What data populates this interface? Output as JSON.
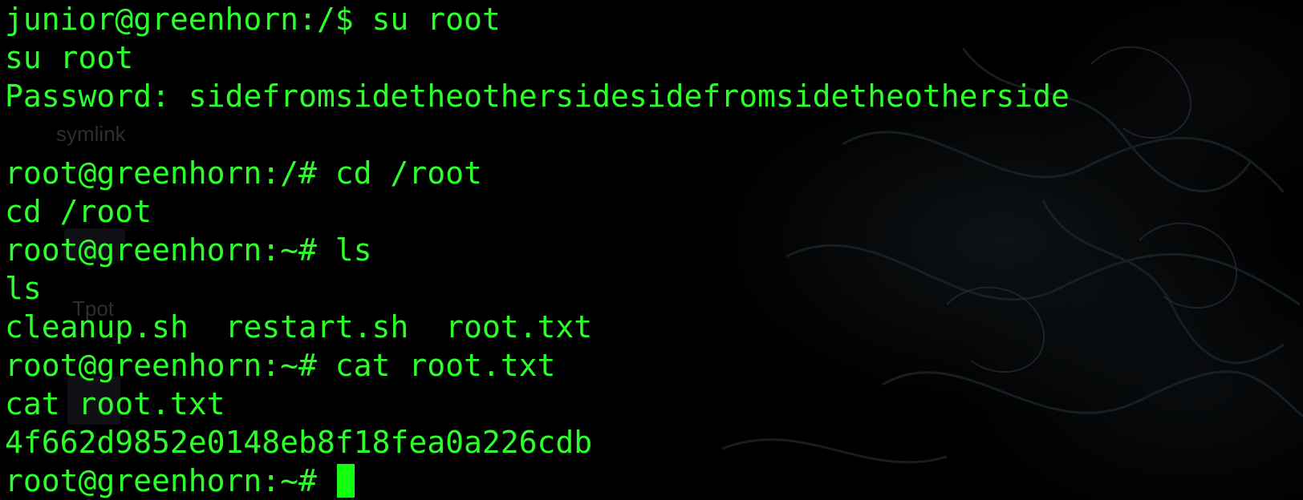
{
  "terminal": {
    "lines": [
      "junior@greenhorn:/$ su root",
      "su root",
      "Password: sidefromsidetheothersidesidefromsidetheotherside",
      "",
      "root@greenhorn:/# cd /root",
      "cd /root",
      "root@greenhorn:~# ls",
      "ls",
      "cleanup.sh  restart.sh  root.txt",
      "root@greenhorn:~# cat root.txt",
      "cat root.txt",
      "4f662d9852e0148eb8f18fea0a226cdb"
    ],
    "current_prompt": "root@greenhorn:~# ",
    "text_color": "#2cff2c",
    "cursor_color": "#12ff12",
    "background_color": "#000000"
  },
  "background": {
    "ghost_labels": [
      "symlink",
      "Tpot"
    ]
  }
}
